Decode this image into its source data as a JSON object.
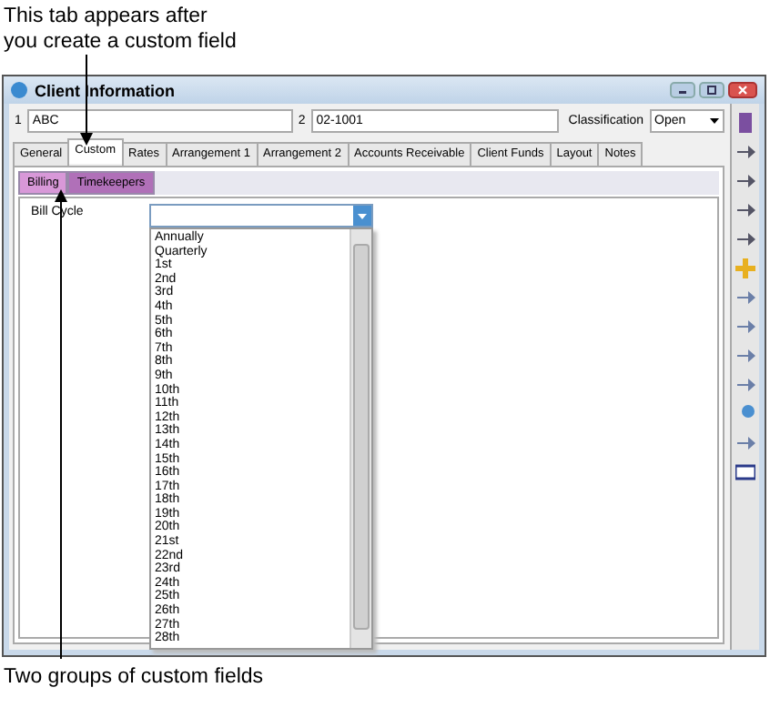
{
  "annotations": {
    "top": "This tab appears after\nyou create a custom field",
    "bottom": "Two groups of custom fields"
  },
  "window": {
    "title": "Client Information"
  },
  "fields": [
    {
      "label": "1",
      "value": "ABC"
    },
    {
      "label": "2",
      "value": "02-1001"
    }
  ],
  "classification": {
    "label": "Classification",
    "value": "Open"
  },
  "tabs": [
    {
      "label": "General",
      "selected": false
    },
    {
      "label": "Custom",
      "selected": true
    },
    {
      "label": "Rates",
      "selected": false
    },
    {
      "label": "Arrangement 1",
      "selected": false
    },
    {
      "label": "Arrangement 2",
      "selected": false
    },
    {
      "label": "Accounts Receivable",
      "selected": false
    },
    {
      "label": "Client Funds",
      "selected": false
    },
    {
      "label": "Layout",
      "selected": false
    },
    {
      "label": "Notes",
      "selected": false
    }
  ],
  "subtabs": [
    {
      "label": "Billing",
      "selected": true
    },
    {
      "label": "Timekeepers",
      "selected": false
    }
  ],
  "bill_cycle": {
    "label": "Bill Cycle",
    "options": [
      "Annually",
      "Quarterly",
      "1st",
      "2nd",
      "3rd",
      "4th",
      "5th",
      "6th",
      "7th",
      "8th",
      "9th",
      "10th",
      "11th",
      "12th",
      "13th",
      "14th",
      "15th",
      "16th",
      "17th",
      "18th",
      "19th",
      "20th",
      "21st",
      "22nd",
      "23rd",
      "24th",
      "25th",
      "26th",
      "27th",
      "28th"
    ]
  }
}
